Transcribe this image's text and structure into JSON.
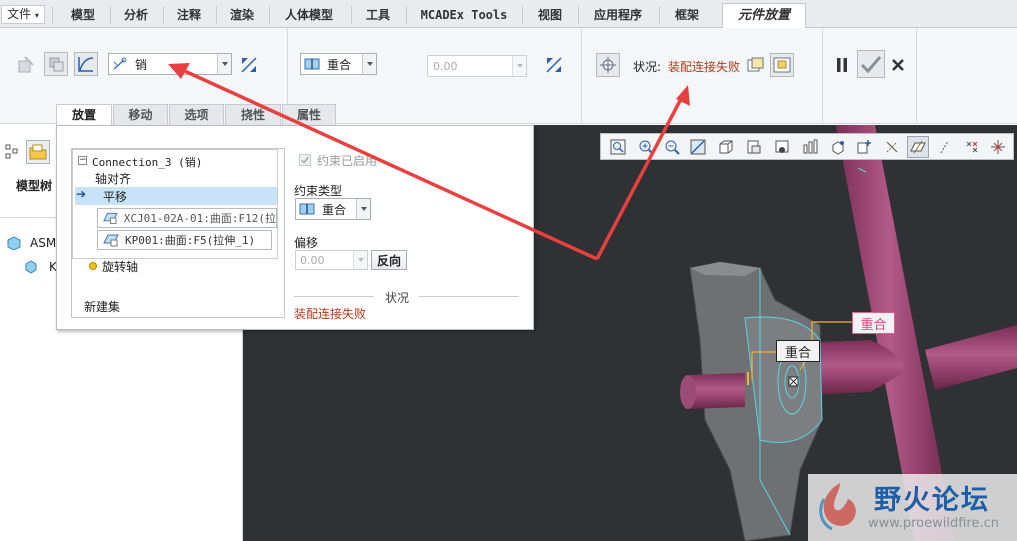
{
  "menubar": {
    "file": "文件",
    "tabs": [
      "模型",
      "分析",
      "注释",
      "渲染",
      "人体模型",
      "工具",
      "MCADEx Tools",
      "视图",
      "应用程序",
      "框架"
    ],
    "active_tab": "元件放置"
  },
  "ribbon": {
    "connection_type": "销",
    "constraint_type": "重合",
    "offset_value": "0.00",
    "status_label": "状况:",
    "status_value": "装配连接失败"
  },
  "subtabs": [
    "放置",
    "移动",
    "选项",
    "挠性",
    "属性"
  ],
  "left_panel": {
    "model_tree_label": "模型树",
    "items": [
      "ASM",
      "K"
    ]
  },
  "dialog": {
    "connection_title": "Connection_3 (销)",
    "axis_align": "轴对齐",
    "translate": "平移",
    "ref1": "XCJ01-02A-01:曲面:F12(拉",
    "ref2": "KP001:曲面:F5(拉伸_1)",
    "rotation_axis": "旋转轴",
    "new_set": "新建集",
    "constraint_enabled": "约束已启用",
    "constraint_type_label": "约束类型",
    "constraint_type_value": "重合",
    "offset_label": "偏移",
    "offset_value": "0.00",
    "flip": "反向",
    "status_heading": "状况",
    "status_value": "装配连接失败"
  },
  "viewport": {
    "label_coincident_1": "重合",
    "label_coincident_2": "重合"
  },
  "watermark": {
    "title": "野火论坛",
    "url": "www.proewildfire.cn"
  },
  "colors": {
    "accent_red": "#e84040",
    "status_red": "#b23a1a",
    "viewport_bg": "#303134",
    "pipe_magenta": "#a84c7a",
    "part_gray": "#6e7074"
  }
}
